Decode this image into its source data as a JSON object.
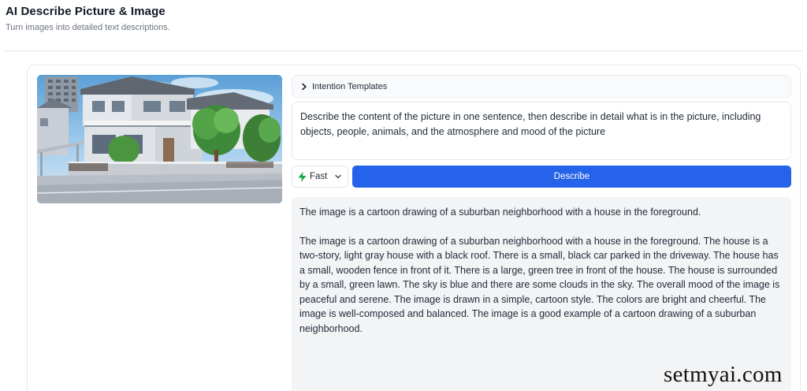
{
  "header": {
    "title": "AI Describe Picture & Image",
    "subtitle": "Turn images into detailed text descriptions."
  },
  "templates": {
    "label": "Intention Templates",
    "icon": "chevron-right-icon"
  },
  "prompt": {
    "value": "Describe the content of the picture in one sentence, then describe in detail what is in the picture, including objects, people, animals, and the atmosphere and mood of the picture"
  },
  "model": {
    "label": "Fast",
    "icon": "bolt-icon",
    "accent": "#16a34a"
  },
  "describe_button": {
    "label": "Describe",
    "color": "#2563eb"
  },
  "result": {
    "summary": "The image is a cartoon drawing of a suburban neighborhood with a house in the foreground.",
    "detail": "The image is a cartoon drawing of a suburban neighborhood with a house in the foreground. The house is a two-story, light gray house with a black roof. There is a small, black car parked in the driveway. The house has a small, wooden fence in front of it. There is a large, green tree in front of the house. The house is surrounded by a small, green lawn. The sky is blue and there are some clouds in the sky. The overall mood of the image is peaceful and serene. The image is drawn in a simple, cartoon style. The colors are bright and cheerful. The image is well-composed and balanced. The image is a good example of a cartoon drawing of a suburban neighborhood."
  },
  "watermark": "setmyai.com"
}
